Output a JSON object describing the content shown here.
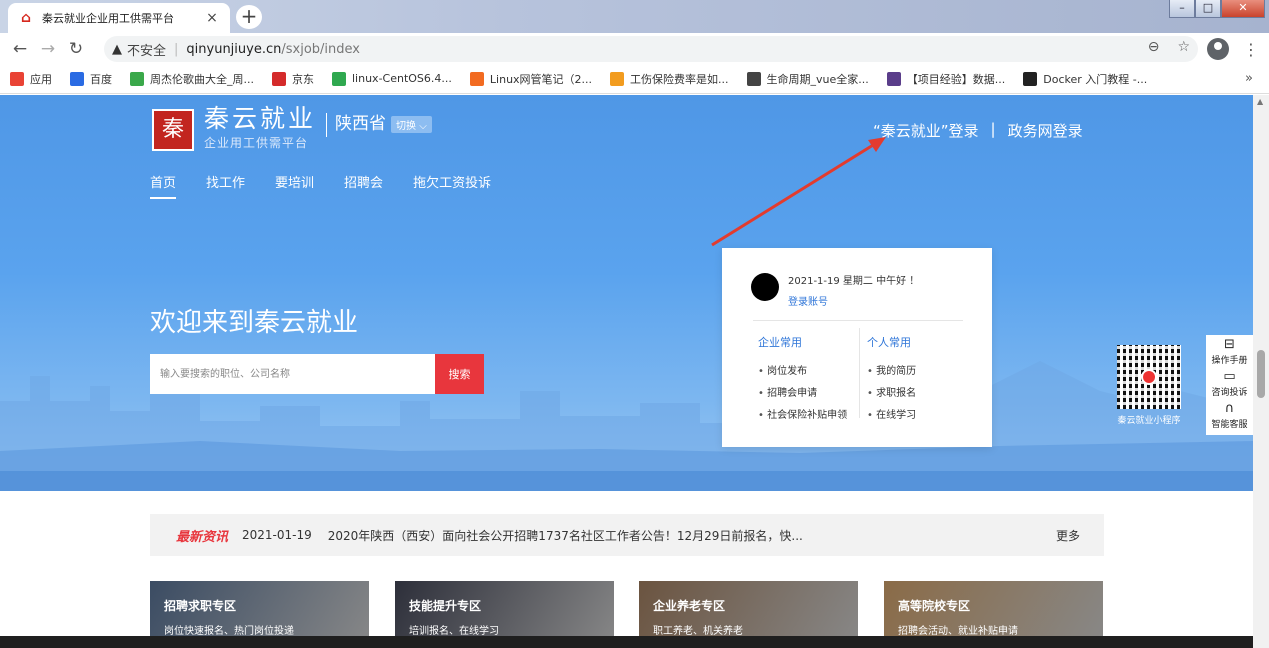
{
  "browser": {
    "tab_title": "秦云就业企业用工供需平台",
    "tab_close": "×",
    "new_tab": "+",
    "url_warning": "不安全",
    "url_host": "qinyunjiuye.cn",
    "url_path": "/sxjob/index",
    "bookmarks": [
      {
        "label": "应用",
        "icon": "apps-grid-icon",
        "color": "#e94335"
      },
      {
        "label": "百度",
        "icon": "baidu-paw-icon",
        "color": "#2a6be3"
      },
      {
        "label": "周杰伦歌曲大全_周...",
        "icon": "bookmark-green-icon",
        "color": "#3aa84a"
      },
      {
        "label": "京东",
        "icon": "jd-icon",
        "color": "#d42b2b"
      },
      {
        "label": "linux-CentOS6.4...",
        "icon": "c-green-icon",
        "color": "#2fa84f"
      },
      {
        "label": "Linux网管笔记（2...",
        "icon": "c-orange-icon",
        "color": "#f26b21"
      },
      {
        "label": "工伤保险费率是如...",
        "icon": "flame-icon",
        "color": "#f29c1f"
      },
      {
        "label": "生命周期_vue全家...",
        "icon": "globe-icon",
        "color": "#444444"
      },
      {
        "label": "【项目经验】数据...",
        "icon": "swirl-icon",
        "color": "#5a3d8a"
      },
      {
        "label": "Docker 入门教程 -...",
        "icon": "brush-icon",
        "color": "#222222"
      }
    ],
    "bookmarks_more": "»"
  },
  "header": {
    "logo_char": "秦",
    "brand_name": "秦云就业",
    "brand_sub": "企业用工供需平台",
    "region": "陕西省",
    "switch_label": "切换",
    "nav": [
      "首页",
      "找工作",
      "要培训",
      "招聘会",
      "拖欠工资投诉"
    ],
    "login_qinyun": "“秦云就业”登录",
    "login_sep": "|",
    "login_gov": "政务网登录"
  },
  "hero": {
    "welcome": "欢迎来到秦云就业",
    "search_placeholder": "输入要搜索的职位、公司名称",
    "search_button": "搜索"
  },
  "user_card": {
    "greeting": "2021-1-19 星期二 中午好 ！",
    "login_link": "登录账号",
    "enterprise_title": "企业常用",
    "enterprise_items": [
      "岗位发布",
      "招聘会申请",
      "社会保险补贴申领"
    ],
    "personal_title": "个人常用",
    "personal_items": [
      "我的简历",
      "求职报名",
      "在线学习"
    ]
  },
  "qr": {
    "label": "秦云就业小程序"
  },
  "side_tools": [
    {
      "icon": "manual-icon",
      "label": "操作手册"
    },
    {
      "icon": "message-icon",
      "label": "咨询投诉"
    },
    {
      "icon": "headset-icon",
      "label": "智能客服"
    }
  ],
  "news": {
    "tag": "最新资讯",
    "date": "2021-01-19",
    "headline": "2020年陕西（西安）面向社会公开招聘1737名社区工作者公告！12月29日前报名，快...",
    "more": "更多"
  },
  "zones": [
    {
      "title": "招聘求职专区",
      "subtitle": "岗位快速报名、热门岗位投递",
      "color": "#3b4c63"
    },
    {
      "title": "技能提升专区",
      "subtitle": "培训报名、在线学习",
      "color": "#2d2f3a"
    },
    {
      "title": "企业养老专区",
      "subtitle": "职工养老、机关养老",
      "color": "#6b5440"
    },
    {
      "title": "高等院校专区",
      "subtitle": "招聘会活动、就业补贴申请",
      "color": "#8a6b47"
    }
  ]
}
